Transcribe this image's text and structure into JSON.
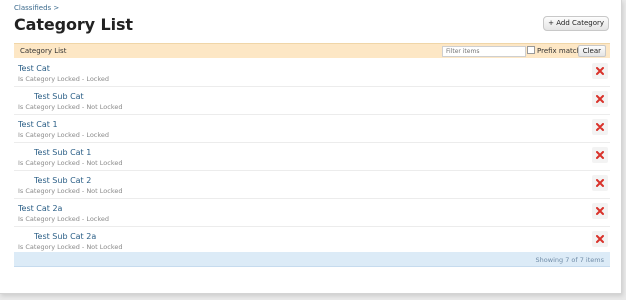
{
  "breadcrumb": "Classifieds >",
  "title": "Category List",
  "add_button": "+ Add Category",
  "list": {
    "header_title": "Category List",
    "filter_placeholder": "Filter items",
    "prefix_label": "Prefix match",
    "clear_label": "Clear",
    "footer_count": "Showing 7 of 7 items"
  },
  "items": [
    {
      "name": "Test Cat",
      "status": "Is Category Locked - Locked"
    },
    {
      "name": "Test Sub Cat",
      "status": "Is Category Locked - Not Locked"
    },
    {
      "name": "Test Cat 1",
      "status": "Is Category Locked - Locked"
    },
    {
      "name": "Test Sub Cat 1",
      "status": "Is Category Locked - Not Locked"
    },
    {
      "name": "Test Sub Cat 2",
      "status": "Is Category Locked - Not Locked"
    },
    {
      "name": "Test Cat 2a",
      "status": "Is Category Locked - Locked"
    },
    {
      "name": "Test Sub Cat 2a",
      "status": "Is Category Locked - Not Locked"
    }
  ],
  "colors": {
    "header_bg": "#fde7c5",
    "footer_bg": "#dcebf7",
    "link": "#2a5e86",
    "delete_icon": "#d9322b"
  },
  "icons": {
    "delete": "delete-x-icon"
  }
}
